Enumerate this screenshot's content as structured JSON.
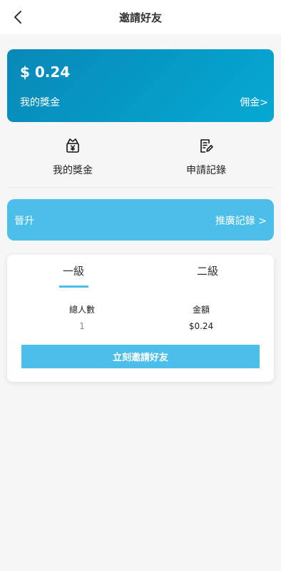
{
  "header": {
    "title": "邀請好友",
    "back_icon": "chevron-left-icon"
  },
  "wallet": {
    "amount": "$ 0.24",
    "my_bonus_label": "我的獎金",
    "commission_link": "佣金>",
    "gradient_colors": [
      "#0888b8",
      "#05a9d3"
    ]
  },
  "shortcuts": [
    {
      "label": "我的獎金",
      "icon": "money-bag-icon"
    },
    {
      "label": "申請記錄",
      "icon": "edit-document-icon"
    }
  ],
  "promo": {
    "left_label": "晉升",
    "right_link": "推廣記錄 >",
    "color": "#4bbfea"
  },
  "levels": {
    "tabs": [
      "一級",
      "二級"
    ],
    "active_tab": 0,
    "columns": [
      {
        "header": "總人數",
        "value": "1"
      },
      {
        "header": "金額",
        "value": "$0.24"
      }
    ],
    "invite_button": "立刻邀請好友",
    "accent": "#4bbfea"
  }
}
